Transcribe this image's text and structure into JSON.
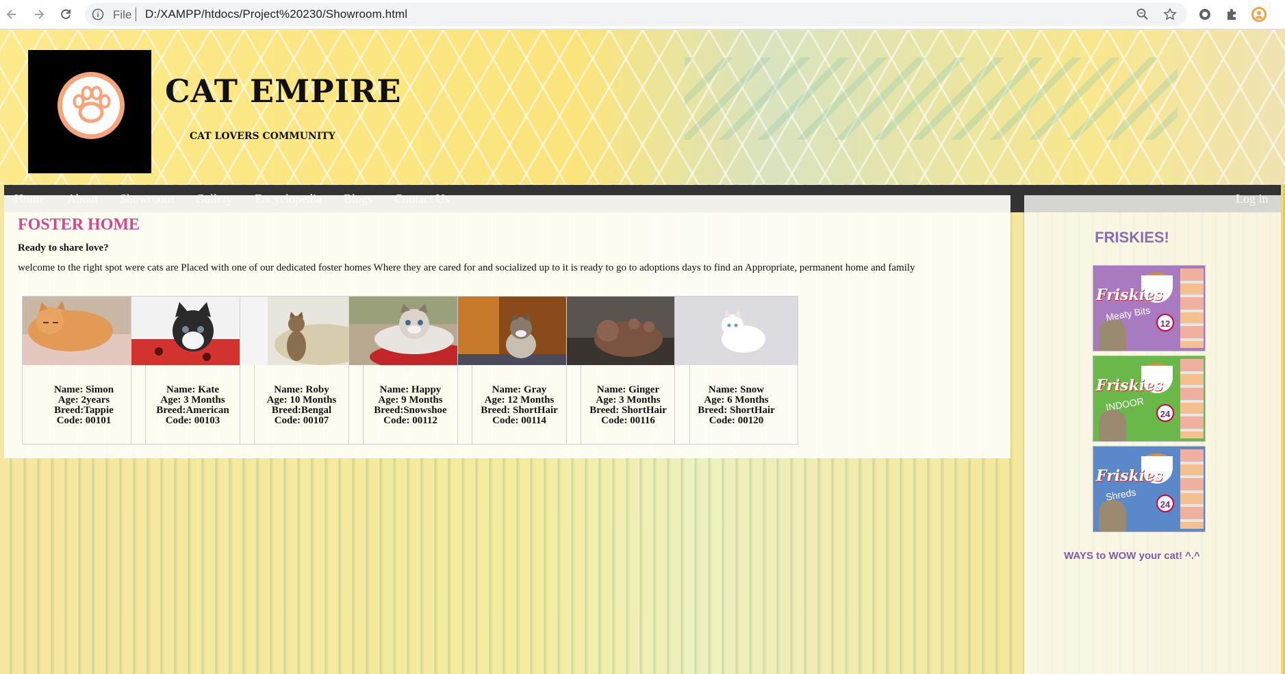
{
  "browser": {
    "scheme_label": "File",
    "url": "D:/XAMPP/htdocs/Project%20230/Showroom.html"
  },
  "header": {
    "title": "CAT EMPIRE",
    "tagline": "CAT LOVERS COMMUNITY"
  },
  "nav": {
    "items": [
      "Home",
      "About",
      "Showroom",
      "Gallery",
      "Encyclopedia",
      "Blogs",
      "Contact Us"
    ],
    "login": "Log in"
  },
  "main": {
    "title": "FOSTER HOME",
    "subtitle": "Ready to share love?",
    "description": "welcome to the right spot were cats are Placed with one of our dedicated foster homes Where they are cared for and socialized up to it is ready to go to adoptions days to find an Appropriate, permanent home and family",
    "cats": [
      {
        "name": "Name: Simon",
        "age": "Age: 2years",
        "breed": "Breed:Tappie",
        "code": "Code: 00101"
      },
      {
        "name": "Name: Kate",
        "age": "Age: 3 Months",
        "breed": "Breed:American",
        "code": "Code: 00103"
      },
      {
        "name": "Name: Roby",
        "age": "Age: 10 Months",
        "breed": "Breed:Bengal",
        "code": "Code: 00107"
      },
      {
        "name": "Name: Happy",
        "age": "Age: 9 Months",
        "breed": "Breed:Snowshoe",
        "code": "Code: 00112"
      },
      {
        "name": "Name: Gray",
        "age": "Age: 12 Months",
        "breed": "Breed: ShortHair",
        "code": "Code: 00114"
      },
      {
        "name": "Name: Ginger",
        "age": "Age: 3 Months",
        "breed": "Breed: ShortHair",
        "code": "Code: 00116"
      },
      {
        "name": "Name: Snow",
        "age": "Age: 6 Months",
        "breed": "Breed: ShortHair",
        "code": "Code: 00120"
      }
    ]
  },
  "sidebar": {
    "title": "FRISKIES!",
    "products": [
      {
        "brand": "Friskies",
        "variant": "Meaty Bits",
        "count": "12"
      },
      {
        "brand": "Friskies",
        "variant": "INDOOR",
        "count": "24"
      },
      {
        "brand": "Friskies",
        "variant": "Shreds",
        "count": "24"
      }
    ],
    "footer": "WAYS to WOW your cat! ^.^"
  },
  "colors": {
    "title_pink": "#d5478d",
    "nav_bg": "#333333",
    "side_purple": "#8a6bb8",
    "logo_orange": "#f7a47a"
  }
}
